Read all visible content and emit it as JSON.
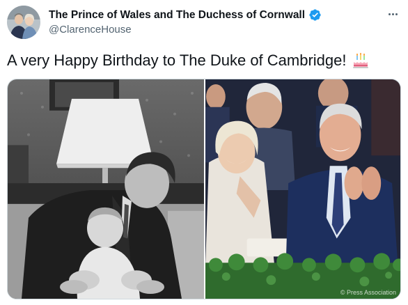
{
  "author": {
    "display_name": "The Prince of Wales and The Duchess of Cornwall",
    "handle": "@ClarenceHouse",
    "verified": true,
    "avatar_icon": "profile-photo"
  },
  "menu": {
    "icon": "more-options-icon"
  },
  "tweet": {
    "text": "A very Happy Birthday to The Duke of Cambridge!",
    "emoji": "birthday-cake-emoji"
  },
  "media": {
    "count": 2,
    "watermark": "© Press Association"
  },
  "colors": {
    "text": "#0f1419",
    "secondary_text": "#536471",
    "verified": "#1d9bf0",
    "border": "#cfd9de"
  }
}
